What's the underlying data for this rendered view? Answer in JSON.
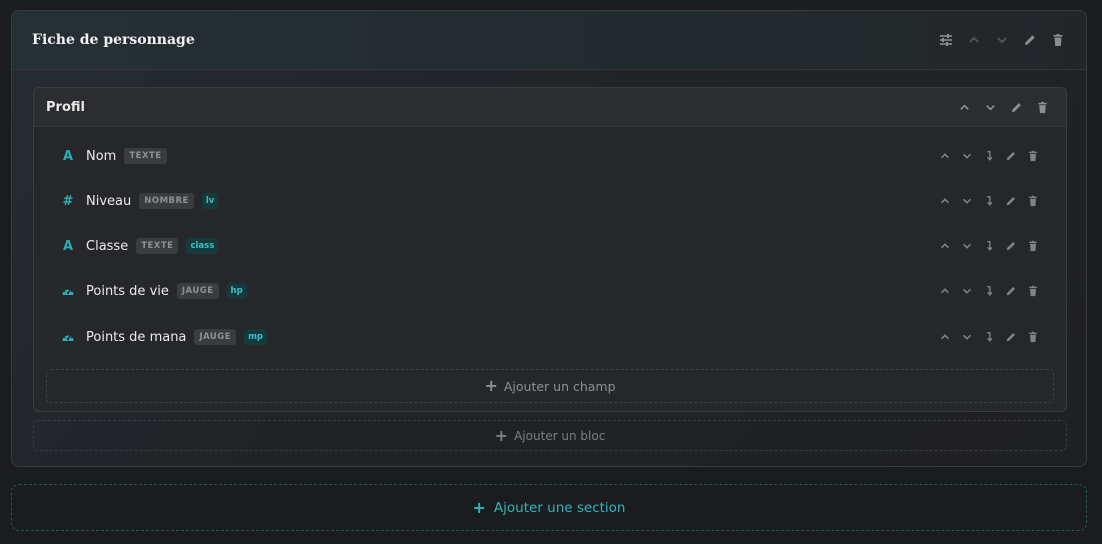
{
  "section": {
    "title": "Fiche de personnage",
    "icons": [
      "sliders-icon",
      "chevron-up-icon",
      "chevron-down-icon",
      "pencil-icon",
      "trash-icon"
    ]
  },
  "block": {
    "title": "Profil",
    "fields": [
      {
        "icon": "text-icon",
        "glyph": "A",
        "name": "Nom",
        "type": "TEXTE",
        "key": ""
      },
      {
        "icon": "number-icon",
        "glyph": "#",
        "name": "Niveau",
        "type": "NOMBRE",
        "key": "lv"
      },
      {
        "icon": "text-icon",
        "glyph": "A",
        "name": "Classe",
        "type": "TEXTE",
        "key": "class"
      },
      {
        "icon": "gauge-icon",
        "glyph": "",
        "name": "Points de vie",
        "type": "JAUGE",
        "key": "hp"
      },
      {
        "icon": "gauge-icon",
        "glyph": "",
        "name": "Points de mana",
        "type": "JAUGE",
        "key": "mp"
      }
    ],
    "add_field_label": "Ajouter un champ"
  },
  "add_block_label": "Ajouter un bloc",
  "add_section_label": "Ajouter une section",
  "colors": {
    "accent": "#2bb0b8",
    "background": "#1b1c1f",
    "icon_muted": "#8a8d92"
  }
}
